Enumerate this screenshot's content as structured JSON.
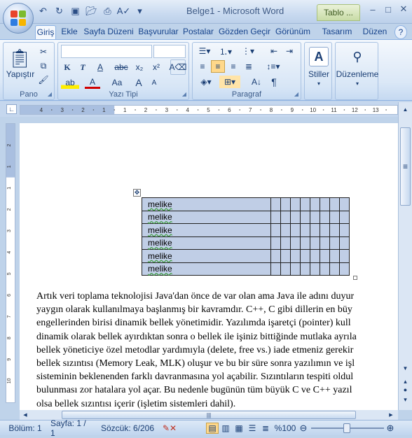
{
  "window": {
    "title": "Belge1 - Microsoft Word",
    "context_tab": "Tablo ..."
  },
  "qat": [
    "undo-icon",
    "redo-icon",
    "save-icon",
    "open-icon",
    "print-icon",
    "spelling-icon",
    "dropdown-icon"
  ],
  "tabs": [
    "Giriş",
    "Ekle",
    "Sayfa Düzeni",
    "Başvurular",
    "Postalar",
    "Gözden Geçir",
    "Görünüm",
    "Tasarım",
    "Düzen"
  ],
  "active_tab": "Giriş",
  "ribbon": {
    "pano": {
      "label": "Pano",
      "paste_label": "Yapıştır"
    },
    "font": {
      "label": "Yazı Tipi",
      "font_name": "",
      "font_size": "",
      "bold": "K",
      "italic": "T",
      "underline": "A",
      "strike": "abc",
      "sub": "x₂",
      "sup": "x²",
      "case": "Aa",
      "grow": "A",
      "shrink": "A"
    },
    "paragraph": {
      "label": "Paragraf",
      "show_marks": "¶"
    },
    "styles": {
      "label": "Stiller"
    },
    "editing": {
      "label": "Düzenleme"
    }
  },
  "ruler_numbers": [
    "4",
    "3",
    "2",
    "1",
    "1",
    "2",
    "3",
    "4",
    "5",
    "6",
    "7",
    "8",
    "9",
    "10",
    "11",
    "12",
    "13"
  ],
  "vruler_numbers": [
    "2",
    "1",
    "1",
    "2",
    "3",
    "4",
    "5",
    "6",
    "7",
    "8",
    "9",
    "10"
  ],
  "table": {
    "rows": [
      "melike",
      "melike",
      "melike",
      "melike",
      "melike",
      "melike"
    ],
    "extra_cols": 8
  },
  "paragraph_lines": [
    "Artık veri toplama teknolojisi Java'dan önce de var olan ama Java ile adını duyur",
    "yaygın olarak kullanılmaya başlanmış bir kavramdır. C++, C gibi dillerin en büy",
    "engellerinden birisi dinamik bellek yönetimidir. Yazılımda işaretçi (pointer) kull",
    "dinamik olarak bellek ayırdıktan sonra o bellek ile işiniz bittiğinde mutlaka ayrıla",
    "bellek yöneticiye özel metodlar yardımıyla (delete, free vs.) iade etmeniz gerekir",
    "bellek sızıntısı (Memory Leak, MLK) oluşur ve bu bir süre sonra yazılımın ve işl",
    "sisteminin beklenenden farklı davranmasına yol açabilir. Sızıntıların tespiti oldul",
    "bulunması zor hatalara yol açar. Bu nedenle bugünün tüm büyük C ve C++ yazıl",
    "olsa bellek sızıntısı içerir (işletim sistemleri dahil)."
  ],
  "status": {
    "section": "Bölüm: 1",
    "page": "Sayfa: 1 / 1",
    "words": "Sözcük: 6/206",
    "zoom": "%100"
  },
  "colors": {
    "accent": "#15428b",
    "ribbon_bg": "#dbe8f7",
    "table_fill": "#c0cee6"
  }
}
